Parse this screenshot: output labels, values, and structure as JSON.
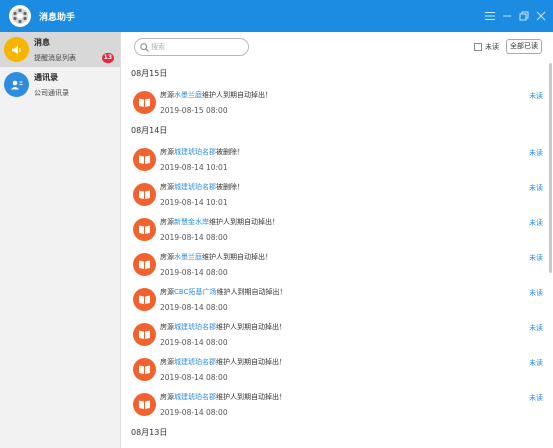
{
  "app": {
    "title": "消息助手"
  },
  "sidebar": {
    "items": [
      {
        "title": "消息",
        "subtitle": "提醒消息列表",
        "badge": "13"
      },
      {
        "title": "通讯录",
        "subtitle": "公司通讯录"
      }
    ]
  },
  "toolbar": {
    "search_placeholder": "搜索",
    "unread_label": "未读",
    "mark_all_label": "全部已读"
  },
  "groups": [
    {
      "date": "08月15日",
      "messages": [
        {
          "prefix": "房源",
          "link": "水墨兰庭",
          "suffix": "维护人到期自动掉出！",
          "time": "2019-08-15 08:00",
          "status": "未读"
        }
      ]
    },
    {
      "date": "08月14日",
      "messages": [
        {
          "prefix": "房源",
          "link": "城建琥珀名郡",
          "suffix": "被删除！",
          "time": "2019-08-14 10:01",
          "status": "未读"
        },
        {
          "prefix": "房源",
          "link": "城建琥珀名郡",
          "suffix": "被删除！",
          "time": "2019-08-14 10:01",
          "status": "未读"
        },
        {
          "prefix": "房源",
          "link": "新慧金水岸",
          "suffix": "维护人到期自动掉出！",
          "time": "2019-08-14 08:00",
          "status": "未读"
        },
        {
          "prefix": "房源",
          "link": "水墨兰庭",
          "suffix": "维护人到期自动掉出！",
          "time": "2019-08-14 08:00",
          "status": "未读"
        },
        {
          "prefix": "房源",
          "link": "CBC拓基广场",
          "suffix": "维护人到期自动掉出！",
          "time": "2019-08-14 08:00",
          "status": "未读"
        },
        {
          "prefix": "房源",
          "link": "城建琥珀名郡",
          "suffix": "维护人到期自动掉出！",
          "time": "2019-08-14 08:00",
          "status": "未读"
        },
        {
          "prefix": "房源",
          "link": "城建琥珀名郡",
          "suffix": "维护人到期自动掉出！",
          "time": "2019-08-14 08:00",
          "status": "未读"
        },
        {
          "prefix": "房源",
          "link": "城建琥珀名郡",
          "suffix": "维护人到期自动掉出！",
          "time": "2019-08-14 08:00",
          "status": "未读"
        }
      ]
    },
    {
      "date": "08月13日",
      "messages": []
    }
  ],
  "colors": {
    "titlebar": "#1c8ce3",
    "message_icon": "#f2622e",
    "nav_message_icon": "#f7b500",
    "nav_contacts_icon": "#2e8ddf",
    "link": "#2e8ddf",
    "badge": "#e8263b"
  },
  "icons": {
    "logo": "app-logo-icon",
    "menu": "menu-icon",
    "minimize": "minimize-icon",
    "restore": "restore-icon",
    "close": "close-icon",
    "nav_messages": "speaker-icon",
    "nav_contacts": "contact-card-icon",
    "search": "search-icon",
    "message": "book-icon"
  }
}
